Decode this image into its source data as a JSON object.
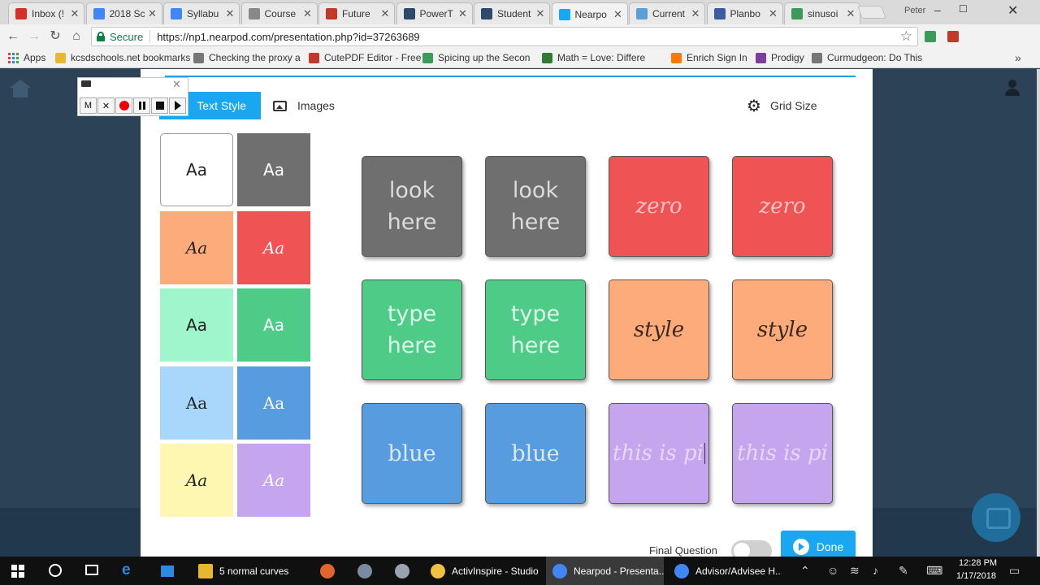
{
  "browser": {
    "tabs": [
      {
        "title": "Inbox (!",
        "color": "#d93025"
      },
      {
        "title": "2018 Sc",
        "color": "#4285f4"
      },
      {
        "title": "Syllabu",
        "color": "#4285f4"
      },
      {
        "title": "Course",
        "color": "#888888"
      },
      {
        "title": "Future",
        "color": "#c0392b"
      },
      {
        "title": "PowerT",
        "color": "#2e4a6b"
      },
      {
        "title": "Student",
        "color": "#2e4a6b"
      },
      {
        "title": "Nearpo",
        "color": "#19a7f1"
      },
      {
        "title": "Current",
        "color": "#5aa0d8"
      },
      {
        "title": "Planbo",
        "color": "#3b5ba5"
      },
      {
        "title": "sinusoi",
        "color": "#3c9b5a"
      }
    ],
    "profile_name": "Peter",
    "secure_label": "Secure",
    "url": "https://np1.nearpod.com/presentation.php?id=37263689",
    "bookmarks": [
      {
        "label": "Apps",
        "color": "#e53935"
      },
      {
        "label": "kcsdschools.net bookmarks",
        "color": "#e8b730"
      },
      {
        "label": "Checking the proxy a",
        "color": "#777777"
      },
      {
        "label": "CutePDF Editor - Free",
        "color": "#c0392b"
      },
      {
        "label": "Spicing up the Secon",
        "color": "#3c9b5a"
      },
      {
        "label": "Math = Love: Differe",
        "color": "#2e7d32"
      },
      {
        "label": "Enrich Sign In",
        "color": "#f57c00"
      },
      {
        "label": "Prodigy",
        "color": "#7b3fa0"
      },
      {
        "label": "Curmudgeon: Do This",
        "color": "#777777"
      }
    ]
  },
  "editor": {
    "tab_text_style": "Text Style",
    "tab_images": "Images",
    "grid_size": "Grid Size",
    "swatches": [
      {
        "label": "Aa",
        "bg": "#ffffff",
        "fg": "#222222",
        "style": "sans"
      },
      {
        "label": "Aa",
        "bg": "#6f6f6f",
        "fg": "#ffffff",
        "style": "sans"
      },
      {
        "label": "Aa",
        "bg": "#fdab7a",
        "fg": "#222222",
        "style": "script"
      },
      {
        "label": "Aa",
        "bg": "#ef5353",
        "fg": "#ffffff",
        "style": "script"
      },
      {
        "label": "Aa",
        "bg": "#9ff5cc",
        "fg": "#222222",
        "style": "sans"
      },
      {
        "label": "Aa",
        "bg": "#4ecb87",
        "fg": "#ffffff",
        "style": "sans"
      },
      {
        "label": "Aa",
        "bg": "#a9d7fb",
        "fg": "#222222",
        "style": "serif"
      },
      {
        "label": "Aa",
        "bg": "#569cdf",
        "fg": "#ffffff",
        "style": "serif"
      },
      {
        "label": "Aa",
        "bg": "#fdf7b1",
        "fg": "#222222",
        "style": "script"
      },
      {
        "label": "Aa",
        "bg": "#c6a5ef",
        "fg": "#ffffff",
        "style": "script"
      }
    ],
    "cards": [
      {
        "text": "look here",
        "bg": "#6f6f6f",
        "fg": "#dcdcdc",
        "style": "sans"
      },
      {
        "text": "look here",
        "bg": "#6f6f6f",
        "fg": "#dcdcdc",
        "style": "sans"
      },
      {
        "text": "zero",
        "bg": "#ef5353",
        "fg": "#fbc3c3",
        "style": "script"
      },
      {
        "text": "zero",
        "bg": "#ef5353",
        "fg": "#fbc3c3",
        "style": "script"
      },
      {
        "text": "type here",
        "bg": "#4ecb87",
        "fg": "#dcf7e7",
        "style": "sans"
      },
      {
        "text": "type here",
        "bg": "#4ecb87",
        "fg": "#dcf7e7",
        "style": "sans"
      },
      {
        "text": "style",
        "bg": "#fdab7a",
        "fg": "#3a2a22",
        "style": "script"
      },
      {
        "text": "style",
        "bg": "#fdab7a",
        "fg": "#3a2a22",
        "style": "script"
      },
      {
        "text": "blue",
        "bg": "#569cdf",
        "fg": "#dbe9f8",
        "style": "serif"
      },
      {
        "text": "blue",
        "bg": "#569cdf",
        "fg": "#dbe9f8",
        "style": "serif"
      },
      {
        "text": "this is pi",
        "bg": "#c6a5ef",
        "fg": "#e6d8f8",
        "style": "script",
        "editing": true
      },
      {
        "text": "this is pi",
        "bg": "#c6a5ef",
        "fg": "#e6d8f8",
        "style": "script"
      }
    ],
    "final_question_label": "Final Question",
    "final_question_on": false,
    "done_label": "Done"
  },
  "recorder": {
    "m_label": "M",
    "close_label": "✕"
  },
  "taskbar": {
    "apps": [
      {
        "label": "5 normal curves",
        "color": "#e8b730",
        "active": false
      },
      {
        "label": "",
        "color": "#e0662e",
        "active": false
      },
      {
        "label": "",
        "color": "#7a8aa0",
        "active": false
      },
      {
        "label": "",
        "color": "#9aa4b0",
        "active": false
      },
      {
        "label": "ActivInspire - Studio",
        "color": "#f0c040",
        "active": false
      },
      {
        "label": "Nearpod - Presenta...",
        "color": "#4285f4",
        "active": true
      },
      {
        "label": "Advisor/Advisee H...",
        "color": "#4285f4",
        "active": false
      }
    ],
    "time": "12:28 PM",
    "date": "1/17/2018"
  }
}
